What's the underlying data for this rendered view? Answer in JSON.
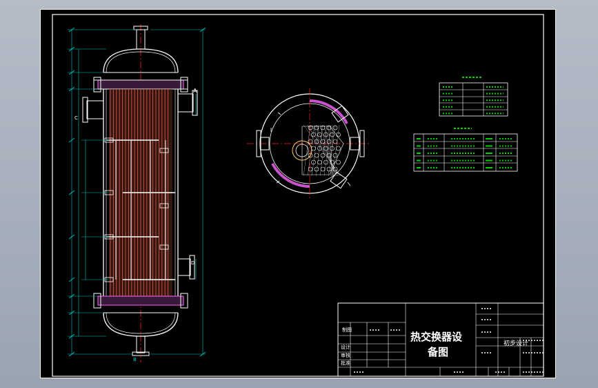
{
  "colors": {
    "background": "#a9b2bf",
    "sheet": "#000000",
    "outline": "#ffffff",
    "hidden": "#d0d0d0",
    "centerline": "#ff2020",
    "dimension": "#00c8c8",
    "hatch": "#ff66ff",
    "tube": "#e05050",
    "table": "#00d000"
  },
  "drawing": {
    "nozzle_labels": [
      "A",
      "C",
      "D",
      "B"
    ]
  },
  "title_block": {
    "title_line1": "热交换器设",
    "title_line2": "备图",
    "stage": "初步设计",
    "design_label": "设计",
    "check_label": "审核",
    "draw_label": "制图",
    "approve_label": "批准"
  },
  "tables": {
    "spec_rows": 5,
    "nozzle_rows": 5
  }
}
